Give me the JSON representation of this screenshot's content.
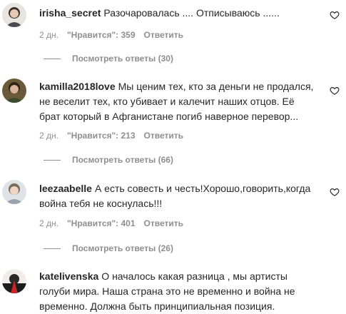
{
  "comments": [
    {
      "username": "irisha_secret",
      "text": "Разочаровалась .... Отписываюсь ......",
      "time": "2 дн.",
      "likes": "\"Нравится\": 359",
      "reply": "Ответить",
      "replies": "Посмотреть ответы (30)"
    },
    {
      "username": "kamilla2018love",
      "text": "Мы ценим тех, кто за деньги не продался, не веселит тех, кто убивает и калечит наших отцов. Её брат который в Афганистане погиб наверное перевор...",
      "time": "2 дн.",
      "likes": "\"Нравится\": 213",
      "reply": "Ответить",
      "replies": "Посмотреть ответы (66)"
    },
    {
      "username": "leezaabelle",
      "text": "А есть совесть и честь!Хорошо,говорить,когда война тебя не коснулась!!!",
      "time": "2 дн.",
      "likes": "\"Нравится\": 401",
      "reply": "Ответить",
      "replies": "Посмотреть ответы (26)"
    },
    {
      "username": "katelivenska",
      "text": "О началось какая разница , мы артисты голуби мира. Наша страна это не временно и война не временно. Должна быть принципиальная позиция.",
      "time": "",
      "likes": "",
      "reply": "",
      "replies": ""
    }
  ],
  "icons": {
    "like": "heart-outline-icon"
  }
}
